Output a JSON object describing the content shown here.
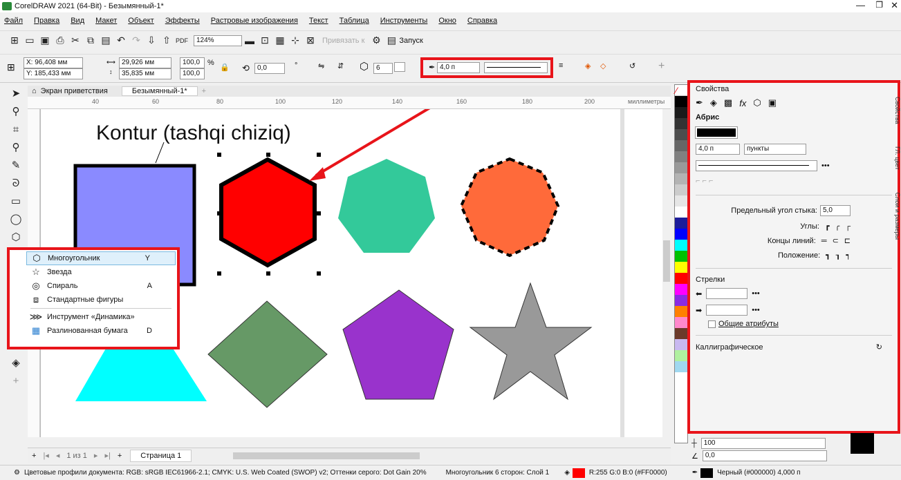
{
  "window": {
    "title": "CorelDRAW 2021 (64-Bit) - Безымянный-1*"
  },
  "menu": [
    "Файл",
    "Правка",
    "Вид",
    "Макет",
    "Объект",
    "Эффекты",
    "Растровые изображения",
    "Текст",
    "Таблица",
    "Инструменты",
    "Окно",
    "Справка"
  ],
  "toolbar": {
    "zoom": "124%",
    "snap_label": "Привязать к",
    "launch_label": "Запуск"
  },
  "propbar": {
    "x": "X: 96,408 мм",
    "y": "Y: 185,433 мм",
    "w": "29,926 мм",
    "h": "35,835 мм",
    "scale_w": "100,0",
    "scale_h": "100,0",
    "pct": "%",
    "angle": "0,0",
    "deg": "°",
    "sides": "6",
    "outline_width": "4,0 п"
  },
  "tabs": {
    "welcome": "Экран приветствия",
    "doc": "Безымянный-1*"
  },
  "ruler": {
    "ticks": [
      "40",
      "60",
      "80",
      "100",
      "120",
      "140",
      "160",
      "180",
      "200"
    ],
    "units": "миллиметры"
  },
  "canvas": {
    "caption": "Kontur (tashqi chiziq)"
  },
  "popup": {
    "items": [
      {
        "label": "Многоугольник",
        "key": "Y",
        "icon": "polygon-icon"
      },
      {
        "label": "Звезда",
        "key": "",
        "icon": "star-icon"
      },
      {
        "label": "Спираль",
        "key": "A",
        "icon": "spiral-icon"
      },
      {
        "label": "Стандартные фигуры",
        "key": "",
        "icon": "basic-shapes-icon"
      },
      {
        "label": "Инструмент «Динамика»",
        "key": "",
        "icon": "dynamics-icon"
      },
      {
        "label": "Разлинованная бумага",
        "key": "D",
        "icon": "graph-paper-icon"
      }
    ]
  },
  "props": {
    "title": "Свойства",
    "section": "Абрис",
    "width": "4,0 п",
    "units": "пункты",
    "miter_label": "Предельный угол стыка:",
    "miter_value": "5,0",
    "corners_label": "Углы:",
    "caps_label": "Концы линий:",
    "position_label": "Положение:",
    "arrows_label": "Стрелки",
    "common_attrs": "Общие атрибуты",
    "calligraphic": "Каллиграфическое",
    "stretch_value": "100",
    "angle_value": "0,0"
  },
  "side_tabs": [
    "Свойства",
    "ГЛ. цвет",
    "Слои и размеры"
  ],
  "pagebar": {
    "page_of": "1 из 1",
    "page_tab": "Страница 1"
  },
  "status": {
    "profiles": "Цветовые профили документа: RGB: sRGB IEC61966-2.1; CMYK: U.S. Web Coated (SWOP) v2; Оттенки серого: Dot Gain 20%",
    "object": "Многоугольник 6 сторон: Слой 1",
    "fill": "R:255 G:0 B:0 (#FF0000)",
    "outline": "Черный (#000000) 4,000 п"
  },
  "colors": {
    "accent_red": "#e8141a",
    "hex_fill": "#ff0000",
    "square": "#8a8aff",
    "heptagon": "#33c99a",
    "octagon": "#ff6a3a",
    "diamond": "#669966",
    "pentagon": "#9933cc",
    "star": "#999999",
    "trapezoid": "#00ffff"
  }
}
